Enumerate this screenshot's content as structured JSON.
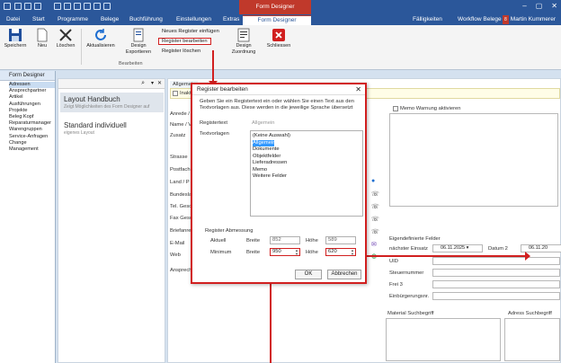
{
  "window": {
    "title": "Demo - blue office 4.1",
    "context_tab": "Form Designer"
  },
  "menu": {
    "items": [
      "Datei",
      "Start",
      "Programme",
      "Belege",
      "Buchführung",
      "Einstellungen",
      "Extras",
      "Form Designer"
    ],
    "right_items": [
      "Fälligkeiten",
      "Workflow Belege",
      "Martin Kummerer"
    ],
    "workflow_badge": "8"
  },
  "ribbon": {
    "save": "Speichern",
    "new": "Neu",
    "delete": "Löschen",
    "refresh": "Aktualisieren",
    "export_line1": "Design",
    "export_line2": "Exportieren",
    "new_register": "Neues Register einfügen",
    "edit_register": "Register bearbeiten",
    "delete_register": "Register löschen",
    "assign_line1": "Design",
    "assign_line2": "Zuordnung",
    "close": "Schliessen",
    "group": "Bearbeiten"
  },
  "left": {
    "header": "Form Designer",
    "items": [
      "Adressen",
      "Ansprechpartner",
      "Artikel",
      "Ausführungen",
      "Projekte",
      "Beleg Kopf",
      "Reparaturmanager",
      "Warengruppen",
      "Service-Anfragen",
      "Change Management"
    ]
  },
  "layouts": [
    {
      "name": "Layout Handbuch",
      "desc": "Zeigt Möglichkeiten des Form Designer auf"
    },
    {
      "name": "Standard individuell",
      "desc": "eigenes Layout"
    }
  ],
  "editor": {
    "tab": "Allgemein",
    "check_inactive": "Inakti",
    "labels": [
      "Anrede /",
      "Name / V",
      "Zusatz",
      "Strasse",
      "Postfach",
      "Land / P",
      "Bundesla",
      "Tel. Gesc",
      "Fax Gesc",
      "Briefanre",
      "E-Mail",
      "Web",
      "Ansprech"
    ],
    "memo_warning": "Memo Warnung aktivieren",
    "custom_fields": "Eigendefinierte Felder",
    "next_use": "nächster Einsatz",
    "date1": "06.11.2025",
    "date2_label": "Datum 2",
    "date2": "06.11.20",
    "uid": "UID",
    "tax_no": "Steuernummer",
    "free3": "Frei 3",
    "naturalization": "Einbürgerungsnr.",
    "material_search": "Material Suchbegriff",
    "address_search": "Adress Suchbegriff"
  },
  "dialog": {
    "title": "Register bearbeiten",
    "intro": "Geben Sie ein Registertext ein oder wählen Sie einen Text aus den Textvorlagen aus. Diese werden in die jeweilige Sprache übersetzt",
    "label_text": "Registertext",
    "text_value": "Allgemein",
    "label_templates": "Textvorlagen",
    "templates": [
      "(Keine Auswahl)",
      "Allgemein",
      "Dokumente",
      "Objektfelder",
      "Lieferadressen",
      "Memo",
      "Weitere Felder"
    ],
    "selected_template": "Allgemein",
    "size_section": "Register Abmessung",
    "current": "Aktuell",
    "minimum": "Minimum",
    "width": "Breite",
    "height": "Höhe",
    "cur_width": "852",
    "cur_height": "589",
    "min_width": "950",
    "min_height": "620",
    "ok": "OK",
    "cancel": "Abbrechen"
  },
  "colors": {
    "titlebar": "#2b579a",
    "accent_red": "#d11f1f",
    "selection": "#3399ff"
  }
}
